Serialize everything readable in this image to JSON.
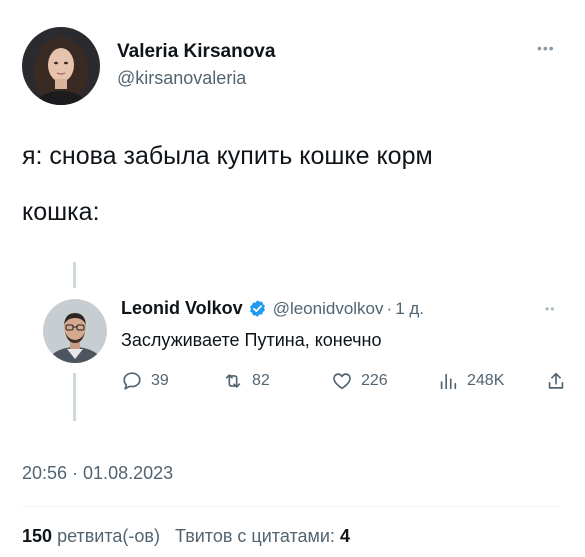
{
  "author": {
    "name": "Valeria Kirsanova",
    "handle": "@kirsanovaleria"
  },
  "tweet": {
    "line1": "я: снова забыла купить кошке корм",
    "line2": "кошка:"
  },
  "quoted_reply": {
    "name": "Leonid Volkov",
    "handle": "@leonidvolkov",
    "separator": "·",
    "time": "1 д.",
    "text": "Заслуживаете Путина, конечно",
    "actions": {
      "replies": "39",
      "retweets": "82",
      "likes": "226",
      "views": "248K"
    }
  },
  "timestamp": "20:56 · 01.08.2023",
  "stats": {
    "retweets_count": "150",
    "retweets_label": "ретвита(-ов)",
    "quotes_label": "Твитов с цитатами:",
    "quotes_count": "4"
  },
  "colors": {
    "text": "#0f1419",
    "secondary": "#536471",
    "verified": "#1d9bf0",
    "thread_line": "#cfd9de"
  }
}
